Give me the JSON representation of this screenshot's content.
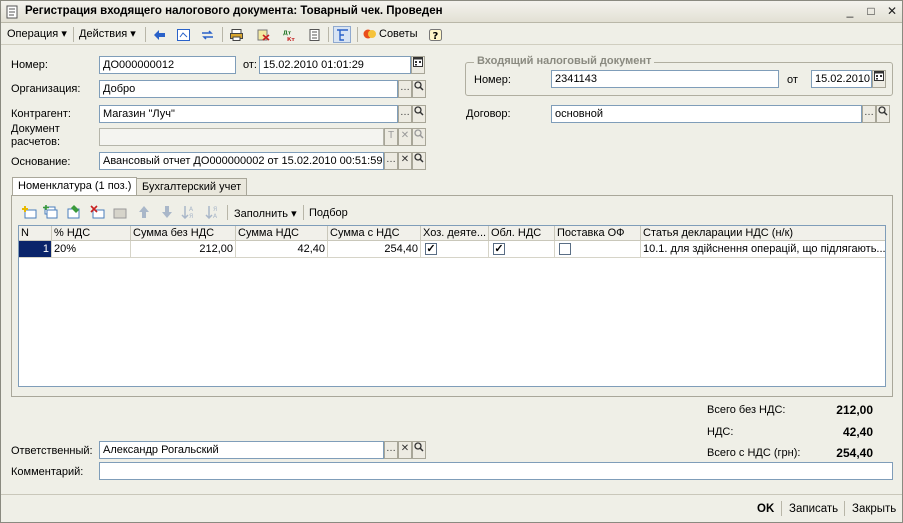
{
  "window": {
    "title": "Регистрация входящего налогового документа: Товарный чек. Проведен",
    "controls": {
      "minimize": "_",
      "maximize": "□",
      "close": "✕"
    }
  },
  "toolbar": {
    "operation": "Операция",
    "actions": "Действия",
    "tips": "Советы",
    "help": "?",
    "icons": [
      "navigate-back-icon",
      "structure-icon",
      "exchange-icon",
      "print-icon",
      "delete-mark-icon",
      "debit-credit-icon",
      "journal-icon",
      "hierarchy-icon",
      "tips-icon",
      "help-icon"
    ]
  },
  "form": {
    "number_label": "Номер:",
    "number_value": "ДО000000012",
    "from_label": "от:",
    "date_value": "15.02.2010 01:01:29",
    "org_label": "Организация:",
    "org_value": "Добро",
    "contractor_label": "Контрагент:",
    "contractor_value": "Магазин \"Луч\"",
    "settlement_label_1": "Документ",
    "settlement_label_2": "расчетов:",
    "settlement_value": "",
    "basis_label": "Основание:",
    "basis_value": "Авансовый отчет ДО000000002 от 15.02.2010 00:51:59",
    "incoming_group_title": "Входящий налоговый документ",
    "incoming_number_label": "Номер:",
    "incoming_number_value": "2341143",
    "incoming_from_label": "от",
    "incoming_date_value": "15.02.2010",
    "contract_label": "Договор:",
    "contract_value": "основной",
    "responsible_label": "Ответственный:",
    "responsible_value": "Александр Рогальский",
    "comment_label": "Комментарий:",
    "comment_value": ""
  },
  "tabs": [
    {
      "label": "Номенклатура (1 поз.)"
    },
    {
      "label": "Бухгалтерский учет"
    }
  ],
  "table_toolbar": {
    "fill": "Заполнить",
    "select": "Подбор"
  },
  "table": {
    "headers": [
      "N",
      "% НДС",
      "Сумма без НДС",
      "Сумма НДС",
      "Сумма с НДС",
      "Хоз. деяте...",
      "Обл. НДС",
      "Поставка ОФ",
      "Статья декларации НДС (н/к)"
    ],
    "rows": [
      {
        "n": "1",
        "vat_rate": "20%",
        "sum_no_vat": "212,00",
        "vat_sum": "42,40",
        "sum_with_vat": "254,40",
        "econ_activity": true,
        "vat_accounting": true,
        "fixed_asset_delivery": false,
        "declaration_article": "10.1. для здійснення операцій, що підлягають..."
      }
    ]
  },
  "totals": {
    "no_vat_label": "Всего без НДС:",
    "no_vat_value": "212,00",
    "vat_label": "НДС:",
    "vat_value": "42,40",
    "with_vat_label": "Всего с НДС (грн):",
    "with_vat_value": "254,40"
  },
  "buttons": {
    "ok": "OK",
    "save": "Записать",
    "close": "Закрыть"
  }
}
